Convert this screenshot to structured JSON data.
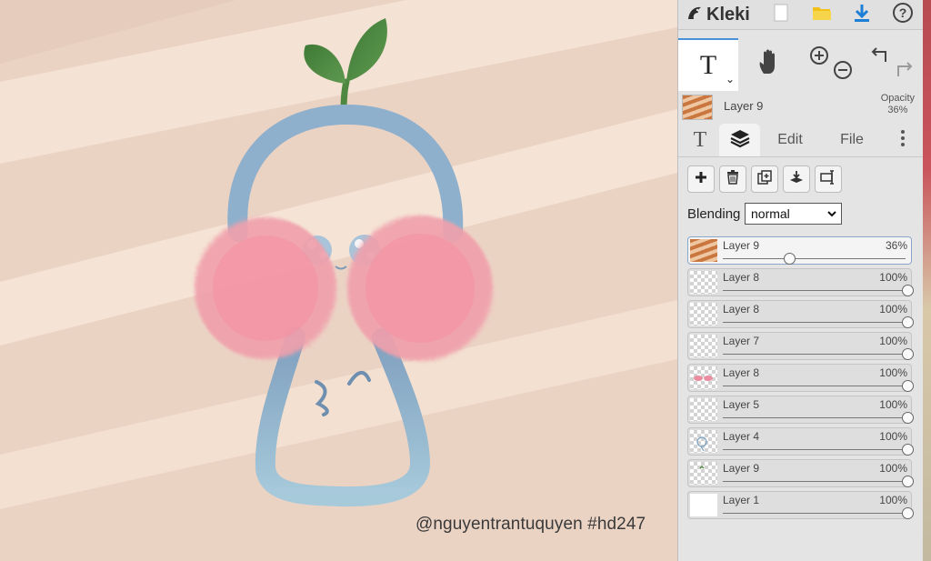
{
  "app": {
    "name": "Kleki"
  },
  "canvas": {
    "watermark": "@nguyentrantuquyen #hd247"
  },
  "toolbar": {
    "active_tool_label": "T"
  },
  "current_layer": {
    "name": "Layer 9",
    "opacity_label": "Opacity",
    "opacity_value": "36%"
  },
  "tabs": [
    {
      "label": "T",
      "icon": "text-tab-icon"
    },
    {
      "label": "",
      "icon": "layers-tab-icon"
    },
    {
      "label": "Edit"
    },
    {
      "label": "File"
    }
  ],
  "blending": {
    "label": "Blending",
    "value": "normal"
  },
  "layers": [
    {
      "name": "Layer 9",
      "opacity": "36%",
      "opacity_value": 0.36,
      "active": true,
      "thumb": "stripes"
    },
    {
      "name": "Layer 8",
      "opacity": "100%",
      "opacity_value": 1.0,
      "thumb": "empty"
    },
    {
      "name": "Layer 8",
      "opacity": "100%",
      "opacity_value": 1.0,
      "thumb": "empty"
    },
    {
      "name": "Layer 7",
      "opacity": "100%",
      "opacity_value": 1.0,
      "thumb": "empty"
    },
    {
      "name": "Layer 8",
      "opacity": "100%",
      "opacity_value": 1.0,
      "thumb": "pink"
    },
    {
      "name": "Layer 5",
      "opacity": "100%",
      "opacity_value": 1.0,
      "thumb": "empty"
    },
    {
      "name": "Layer 4",
      "opacity": "100%",
      "opacity_value": 1.0,
      "thumb": "blue"
    },
    {
      "name": "Layer 9",
      "opacity": "100%",
      "opacity_value": 1.0,
      "thumb": "green"
    },
    {
      "name": "Layer 1",
      "opacity": "100%",
      "opacity_value": 1.0,
      "thumb": "white"
    }
  ],
  "colors": {
    "accent": "#4a90d9",
    "download": "#1e7fd6",
    "folder": "#f2c018"
  }
}
